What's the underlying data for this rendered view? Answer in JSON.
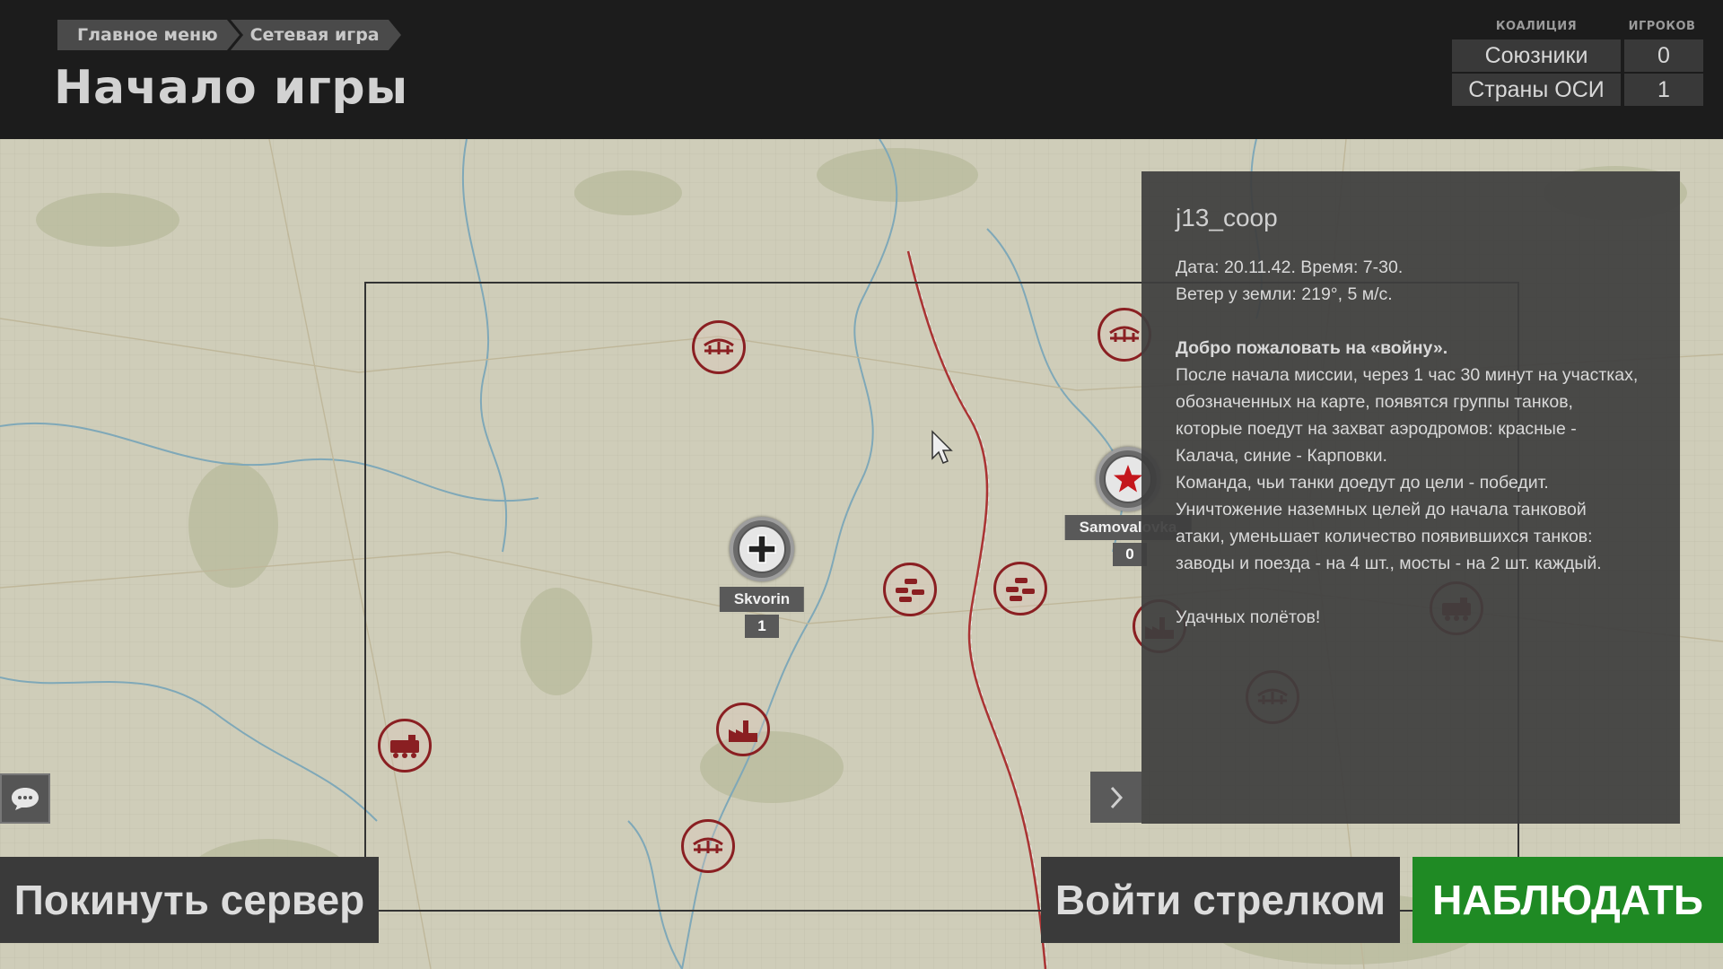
{
  "header": {
    "breadcrumb": [
      "Главное меню",
      "Сетевая игра"
    ],
    "title": "Начало игры"
  },
  "coalitions": {
    "col_coalition": "КОАЛИЦИЯ",
    "col_players": "ИГРОКОВ",
    "rows": [
      {
        "name": "Союзники",
        "players": "0"
      },
      {
        "name": "Страны ОСИ",
        "players": "1"
      }
    ]
  },
  "map": {
    "bases": [
      {
        "name": "Skvorin",
        "count": "1",
        "side": "axis"
      },
      {
        "name": "Samovalovka",
        "count": "0",
        "side": "allies"
      }
    ],
    "target_icons": [
      "bridge-icon",
      "bridge-icon",
      "tanks-icon",
      "tanks-icon",
      "factory-icon",
      "factory-icon",
      "train-icon",
      "train-icon",
      "bridge-icon",
      "bridge-icon"
    ],
    "colors": {
      "target": "#8a1f22",
      "terrain": "#cfcdb9",
      "river": "#7fa8b8",
      "railway": "#a33"
    }
  },
  "mission": {
    "name": "j13_coop",
    "date_time": "Дата: 20.11.42. Время: 7-30.",
    "wind": "Ветер у земли: 219°, 5 м/с.",
    "welcome": "Добро пожаловать на «войну».",
    "lines": [
      "После начала миссии, через 1 час 30 минут на участках,",
      "обозначенных на карте, появятся группы танков,",
      "которые поедут на захват аэродромов: красные -",
      "Калача, синие - Карповки.",
      "Команда, чьи танки доедут до цели - победит.",
      "Уничтожение наземных целей до начала танковой",
      "атаки, уменьшает количество появившихся танков:",
      "заводы и поезда - на 4 шт., мосты - на 2 шт. каждый."
    ],
    "farewell": "Удачных полётов!"
  },
  "buttons": {
    "leave": "Покинуть сервер",
    "gunner": "Войти стрелком",
    "watch": "НАБЛЮДАТЬ"
  },
  "colors": {
    "watch_button": "#1f8a24",
    "panel": "#3e3e3e",
    "header": "#1c1c1c"
  }
}
